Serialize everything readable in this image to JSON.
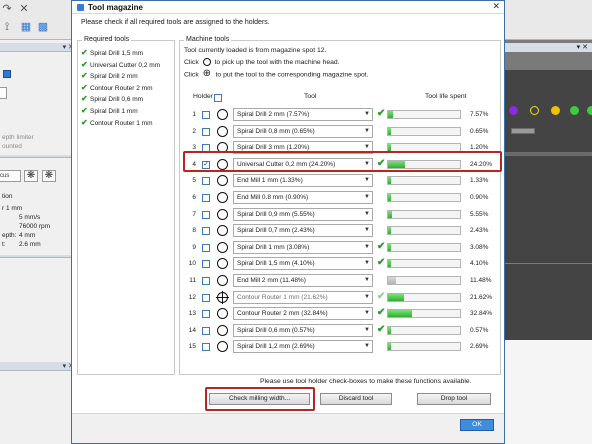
{
  "dialog": {
    "title": "Tool magazine",
    "instruction": "Please check if all required tools are assigned to the holders.",
    "required_tools_label": "Required tools",
    "machine_tools_label": "Machine tools",
    "loaded_text": "Tool currently loaded is from magazine spot 12.",
    "click_word": "Click",
    "pickup_text": "to pick up the tool with the machine head.",
    "put_text": "to put the tool to the corresponding magazine spot.",
    "col_holder": "Holder",
    "col_tool": "Tool",
    "col_life": "Tool life spent",
    "footer_note": "Please use tool holder check-boxes to make these functions available.",
    "btn_check_width": "Check milling width...",
    "btn_discard": "Discard tool",
    "btn_drop": "Drop tool",
    "btn_ok": "OK"
  },
  "required_tools": [
    "Spiral Drill  1,5 mm",
    "Universal Cutter 0,2 mm",
    "Spiral Drill  2 mm",
    "Contour Router 2 mm",
    "Spiral Drill  0,6 mm",
    "Spiral Drill  1 mm",
    "Contour Router 1 mm"
  ],
  "holders": [
    {
      "num": "1",
      "tool": "Spiral Drill   2 mm (7.57%)",
      "ok": true,
      "life": 0.0757,
      "pct": "7.57%",
      "checked": false,
      "icon": "circle"
    },
    {
      "num": "2",
      "tool": "Spiral Drill   0,8 mm (0.65%)",
      "ok": false,
      "life": 0.0065,
      "pct": "0.65%",
      "checked": false,
      "icon": "circle"
    },
    {
      "num": "3",
      "tool": "Spiral Drill   3 mm (1.20%)",
      "ok": false,
      "life": 0.012,
      "pct": "1.20%",
      "checked": false,
      "icon": "circle"
    },
    {
      "num": "4",
      "tool": "Universal Cutter 0,2 mm (24.20%)",
      "ok": true,
      "life": 0.242,
      "pct": "24.20%",
      "checked": true,
      "icon": "circle"
    },
    {
      "num": "5",
      "tool": "End Mill 1 mm (1.33%)",
      "ok": false,
      "life": 0.0133,
      "pct": "1.33%",
      "checked": false,
      "icon": "circle"
    },
    {
      "num": "6",
      "tool": "End Mill 0.8 mm (0.90%)",
      "ok": false,
      "life": 0.009,
      "pct": "0.90%",
      "checked": false,
      "icon": "circle"
    },
    {
      "num": "7",
      "tool": "Spiral Drill   0,9 mm (5.55%)",
      "ok": false,
      "life": 0.0555,
      "pct": "5.55%",
      "checked": false,
      "icon": "circle"
    },
    {
      "num": "8",
      "tool": "Spiral Drill   0,7 mm (2.43%)",
      "ok": false,
      "life": 0.0243,
      "pct": "2.43%",
      "checked": false,
      "icon": "circle"
    },
    {
      "num": "9",
      "tool": "Spiral Drill   1 mm (3.08%)",
      "ok": true,
      "life": 0.0308,
      "pct": "3.08%",
      "checked": false,
      "icon": "circle"
    },
    {
      "num": "10",
      "tool": "Spiral Drill   1,5 mm (4.10%)",
      "ok": true,
      "life": 0.041,
      "pct": "4.10%",
      "checked": false,
      "icon": "circle"
    },
    {
      "num": "11",
      "tool": "End Mill 2 mm (11.48%)",
      "ok": false,
      "life": 0.1148,
      "pct": "11.48%",
      "checked": false,
      "icon": "circle",
      "gray": true
    },
    {
      "num": "12",
      "tool": "Contour Router 1 mm (21.62%)",
      "ok": true,
      "life": 0.2162,
      "pct": "21.62%",
      "checked": false,
      "icon": "cross",
      "disabled": true,
      "dim": true
    },
    {
      "num": "13",
      "tool": "Contour Router 2 mm (32.84%)",
      "ok": true,
      "life": 0.3284,
      "pct": "32.84%",
      "checked": false,
      "icon": "circle"
    },
    {
      "num": "14",
      "tool": "Spiral Drill   0,6 mm (0.57%)",
      "ok": true,
      "life": 0.0057,
      "pct": "0.57%",
      "checked": false,
      "icon": "circle"
    },
    {
      "num": "15",
      "tool": "Spiral Drill   1,2 mm (2.69%)",
      "ok": false,
      "life": 0.0269,
      "pct": "2.69%",
      "checked": false,
      "icon": "circle"
    }
  ],
  "background": {
    "depth_limiter": "epth limiter",
    "mounted": "ounted",
    "cus": "cus",
    "section": "tion",
    "tool_line": "r 1 mm",
    "speed": "5 mm/s",
    "rpm": "76000 rpm",
    "depth_label": "epth:",
    "depth_val": "4 mm",
    "t_label": "t:",
    "t_val": "2.6 mm"
  },
  "colors": {
    "accent": "#3f8ede",
    "highlight": "#b9251f",
    "ok_green": "#2a9a2a"
  }
}
